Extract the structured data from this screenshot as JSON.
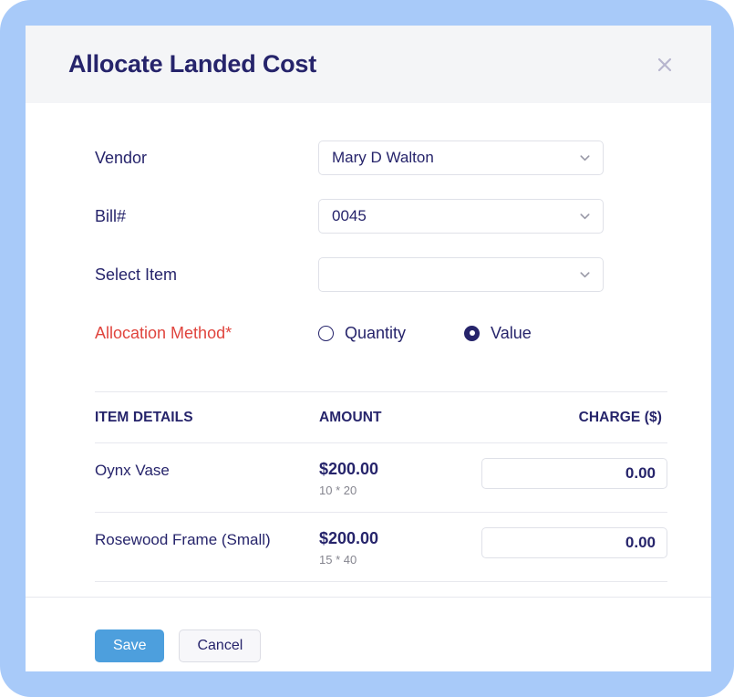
{
  "modal": {
    "title": "Allocate Landed Cost",
    "close_icon": "close-icon"
  },
  "form": {
    "vendor": {
      "label": "Vendor",
      "value": "Mary D Walton",
      "chevron_icon": "chevron-down-icon"
    },
    "bill": {
      "label": "Bill#",
      "value": "0045",
      "chevron_icon": "chevron-down-icon"
    },
    "select_item": {
      "label": "Select Item",
      "value": "",
      "chevron_icon": "chevron-down-icon"
    },
    "allocation_method": {
      "label": "Allocation  Method*",
      "options": [
        {
          "label": "Quantity",
          "selected": false
        },
        {
          "label": "Value",
          "selected": true
        }
      ]
    }
  },
  "table": {
    "headers": {
      "item": "ITEM DETAILS",
      "amount": "AMOUNT",
      "charge": "CHARGE ($)"
    },
    "rows": [
      {
        "item": "Oynx Vase",
        "amount": "$200.00",
        "amount_sub": "10 * 20",
        "charge": "0.00"
      },
      {
        "item": "Rosewood Frame (Small)",
        "amount": "$200.00",
        "amount_sub": "15 * 40",
        "charge": "0.00"
      }
    ]
  },
  "footer": {
    "save_label": "Save",
    "cancel_label": "Cancel"
  },
  "colors": {
    "frame": "#a8caf9",
    "title": "#26246b",
    "required": "#e0453e",
    "save_button": "#4d9fdd",
    "header_bg": "#f4f5f7"
  }
}
